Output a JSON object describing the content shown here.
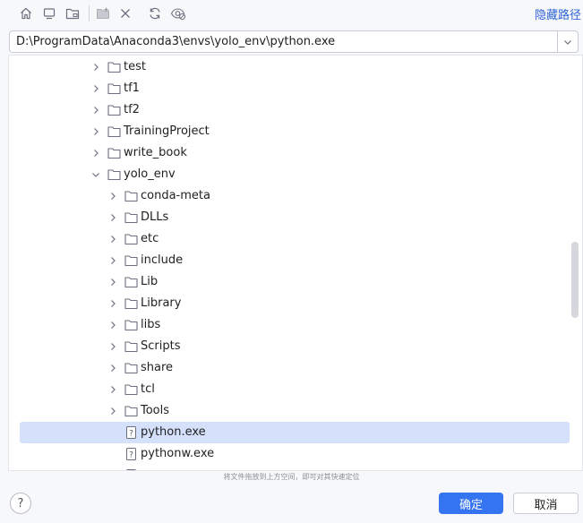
{
  "toolbar": {
    "buttons": [
      {
        "name": "home-icon"
      },
      {
        "name": "desktop-icon"
      },
      {
        "name": "project-folder-icon"
      },
      {
        "name": "new-folder-icon"
      },
      {
        "name": "delete-icon"
      },
      {
        "name": "refresh-icon"
      },
      {
        "name": "show-hidden-icon"
      }
    ],
    "hide_path_label": "隐藏路径"
  },
  "path": {
    "value": "D:\\ProgramData\\Anaconda3\\envs\\yolo_env\\python.exe"
  },
  "tree": {
    "rows": [
      {
        "label": "test",
        "level": 0,
        "type": "folder",
        "expanded": false
      },
      {
        "label": "tf1",
        "level": 0,
        "type": "folder",
        "expanded": false
      },
      {
        "label": "tf2",
        "level": 0,
        "type": "folder",
        "expanded": false
      },
      {
        "label": "TrainingProject",
        "level": 0,
        "type": "folder",
        "expanded": false
      },
      {
        "label": "write_book",
        "level": 0,
        "type": "folder",
        "expanded": false
      },
      {
        "label": "yolo_env",
        "level": 0,
        "type": "folder",
        "expanded": true
      },
      {
        "label": "conda-meta",
        "level": 1,
        "type": "folder",
        "expanded": false
      },
      {
        "label": "DLLs",
        "level": 1,
        "type": "folder",
        "expanded": false
      },
      {
        "label": "etc",
        "level": 1,
        "type": "folder",
        "expanded": false
      },
      {
        "label": "include",
        "level": 1,
        "type": "folder",
        "expanded": false
      },
      {
        "label": "Lib",
        "level": 1,
        "type": "folder",
        "expanded": false
      },
      {
        "label": "Library",
        "level": 1,
        "type": "folder",
        "expanded": false
      },
      {
        "label": "libs",
        "level": 1,
        "type": "folder",
        "expanded": false
      },
      {
        "label": "Scripts",
        "level": 1,
        "type": "folder",
        "expanded": false
      },
      {
        "label": "share",
        "level": 1,
        "type": "folder",
        "expanded": false
      },
      {
        "label": "tcl",
        "level": 1,
        "type": "folder",
        "expanded": false
      },
      {
        "label": "Tools",
        "level": 1,
        "type": "folder",
        "expanded": false
      },
      {
        "label": "python.exe",
        "level": 1,
        "type": "file",
        "selected": true
      },
      {
        "label": "pythonw.exe",
        "level": 1,
        "type": "file"
      },
      {
        "label": "",
        "level": 1,
        "type": "file"
      }
    ]
  },
  "hint": "将文件拖放到上方空间，即可对其快速定位",
  "footer": {
    "help_label": "?",
    "ok_label": "确定",
    "cancel_label": "取消"
  },
  "colors": {
    "accent": "#3574f0",
    "selection": "#d5e1fb",
    "link": "#2f62d6"
  }
}
